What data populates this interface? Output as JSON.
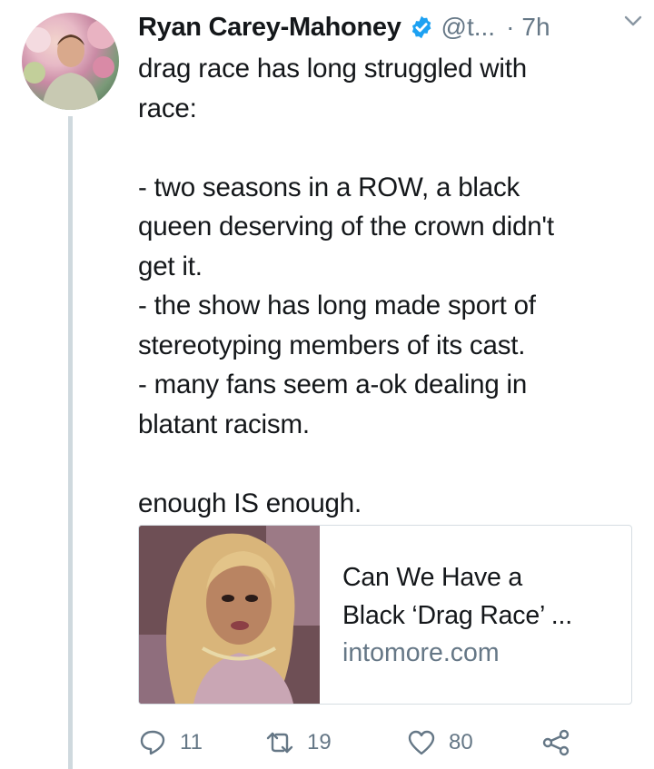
{
  "tweet": {
    "author_name": "Ryan Carey-Mahoney",
    "handle": "@t...",
    "separator": "·",
    "time": "7h",
    "text": "drag race has long struggled with\nrace:\n\n- two seasons in a ROW, a black\nqueen deserving of the crown didn't\nget it.\n- the show has long made sport of\nstereotyping members of its cast.\n- many fans seem a-ok dealing in\nblatant racism.\n\nenough IS enough.",
    "verified": true
  },
  "card": {
    "title": "Can We Have a\nBlack ‘Drag Race’ ...",
    "domain": "intomore.com",
    "image_icon": "card-thumbnail"
  },
  "actions": {
    "reply_count": "11",
    "retweet_count": "19",
    "like_count": "80"
  },
  "colors": {
    "text": "#14171a",
    "secondary": "#657786",
    "verified": "#1da1f2",
    "thread_line": "#cfd9de"
  }
}
